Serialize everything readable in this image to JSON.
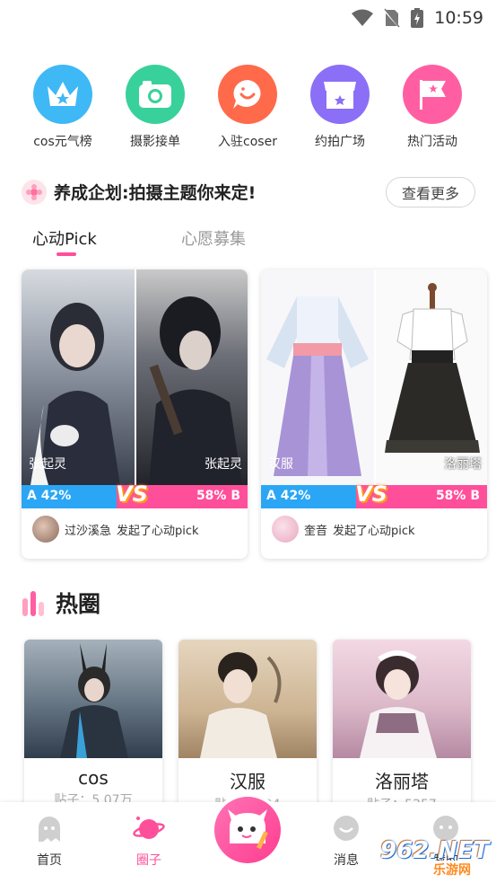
{
  "status": {
    "time": "10:59"
  },
  "quick_menu": [
    {
      "label": "cos元气榜",
      "icon": "crown-icon",
      "color": "#3fb8f6"
    },
    {
      "label": "摄影接单",
      "icon": "camera-icon",
      "color": "#38d19b"
    },
    {
      "label": "入驻coser",
      "icon": "chat-face-icon",
      "color": "#ff6a4b"
    },
    {
      "label": "约拍广场",
      "icon": "shop-icon",
      "color": "#8b6ff7"
    },
    {
      "label": "热门活动",
      "icon": "flag-icon",
      "color": "#ff5fa2"
    }
  ],
  "plan": {
    "title": "养成企划:拍摄主题你来定!",
    "more_label": "查看更多"
  },
  "tabs": {
    "active": "心动Pick",
    "inactive": "心愿募集"
  },
  "picks": [
    {
      "left_name": "张起灵",
      "right_name": "张起灵",
      "a_label": "A 42%",
      "b_label": "58% B",
      "a_percent": 42,
      "b_percent": 58,
      "user": "过沙溪急",
      "action": "发起了心动pick"
    },
    {
      "left_name": "汉服",
      "right_name": "洛丽塔",
      "a_label": "A 42%",
      "b_label": "58% B",
      "a_percent": 42,
      "b_percent": 58,
      "user": "奎音",
      "action": "发起了心动pick"
    }
  ],
  "vs_label": "VS",
  "hot": {
    "title": "热圈",
    "items": [
      {
        "name": "cos",
        "count": "贴子：5.07万"
      },
      {
        "name": "汉服",
        "count": "贴子：1.24"
      },
      {
        "name": "洛丽塔",
        "count": "贴子：5257"
      }
    ]
  },
  "bottom_nav": {
    "home": "首页",
    "circle": "圈子",
    "message": "消息",
    "mine": "我的"
  },
  "watermark": {
    "text": "962.NET",
    "sub": "乐游网"
  },
  "colors": {
    "accent": "#ff4f9a",
    "blue": "#2ba6f5"
  }
}
